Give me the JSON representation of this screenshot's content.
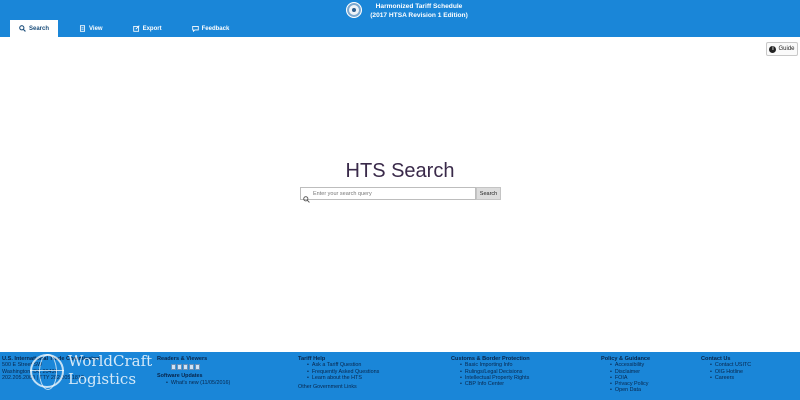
{
  "header": {
    "title_line1": "Harmonized Tariff Schedule",
    "title_line2": "(2017 HTSA Revision 1 Edition)",
    "tabs": [
      {
        "label": "Search",
        "icon": "search-icon",
        "active": true
      },
      {
        "label": "View",
        "icon": "document-icon"
      },
      {
        "label": "Export",
        "icon": "export-icon"
      },
      {
        "label": "Feedback",
        "icon": "feedback-icon"
      }
    ]
  },
  "guide": {
    "label": "Guide",
    "icon": "info-icon"
  },
  "search": {
    "title": "HTS Search",
    "placeholder": "Enter your search query",
    "button_label": "Search"
  },
  "footer": {
    "col1": {
      "title": "U.S. International Trade Commission",
      "lines": [
        "500 E Street SW",
        "Washington, DC 20436",
        "202.205.2000  |  TTY 202.205.1810"
      ]
    },
    "col2": {
      "title": "Readers & Viewers",
      "sub": "Software Updates",
      "items": [
        "What's new (11/05/2016)"
      ]
    },
    "col3": {
      "title": "Tariff Help",
      "items": [
        "Ask a Tariff Question",
        "Frequently Asked Questions",
        "Learn about the HTS"
      ],
      "other": "Other Government Links"
    },
    "col4": {
      "title": "Customs & Border Protection",
      "items": [
        "Basic Importing Info",
        "Rulings/Legal Decisions",
        "Intellectual Property Rights",
        "CBP Info Center"
      ]
    },
    "col5": {
      "title": "Policy & Guidance",
      "items": [
        "Accessibility",
        "Disclaimer",
        "FOIA",
        "Privacy Policy",
        "Open Data"
      ]
    },
    "col6": {
      "title": "Contact Us",
      "items": [
        "Contact USITC",
        "OIG Hotline",
        "Careers"
      ]
    }
  },
  "watermark": {
    "line1": "WorldCraft",
    "line2": "Logistics"
  },
  "colors": {
    "header_blue": "#1a86d8",
    "title_text": "#3a2a4a"
  }
}
